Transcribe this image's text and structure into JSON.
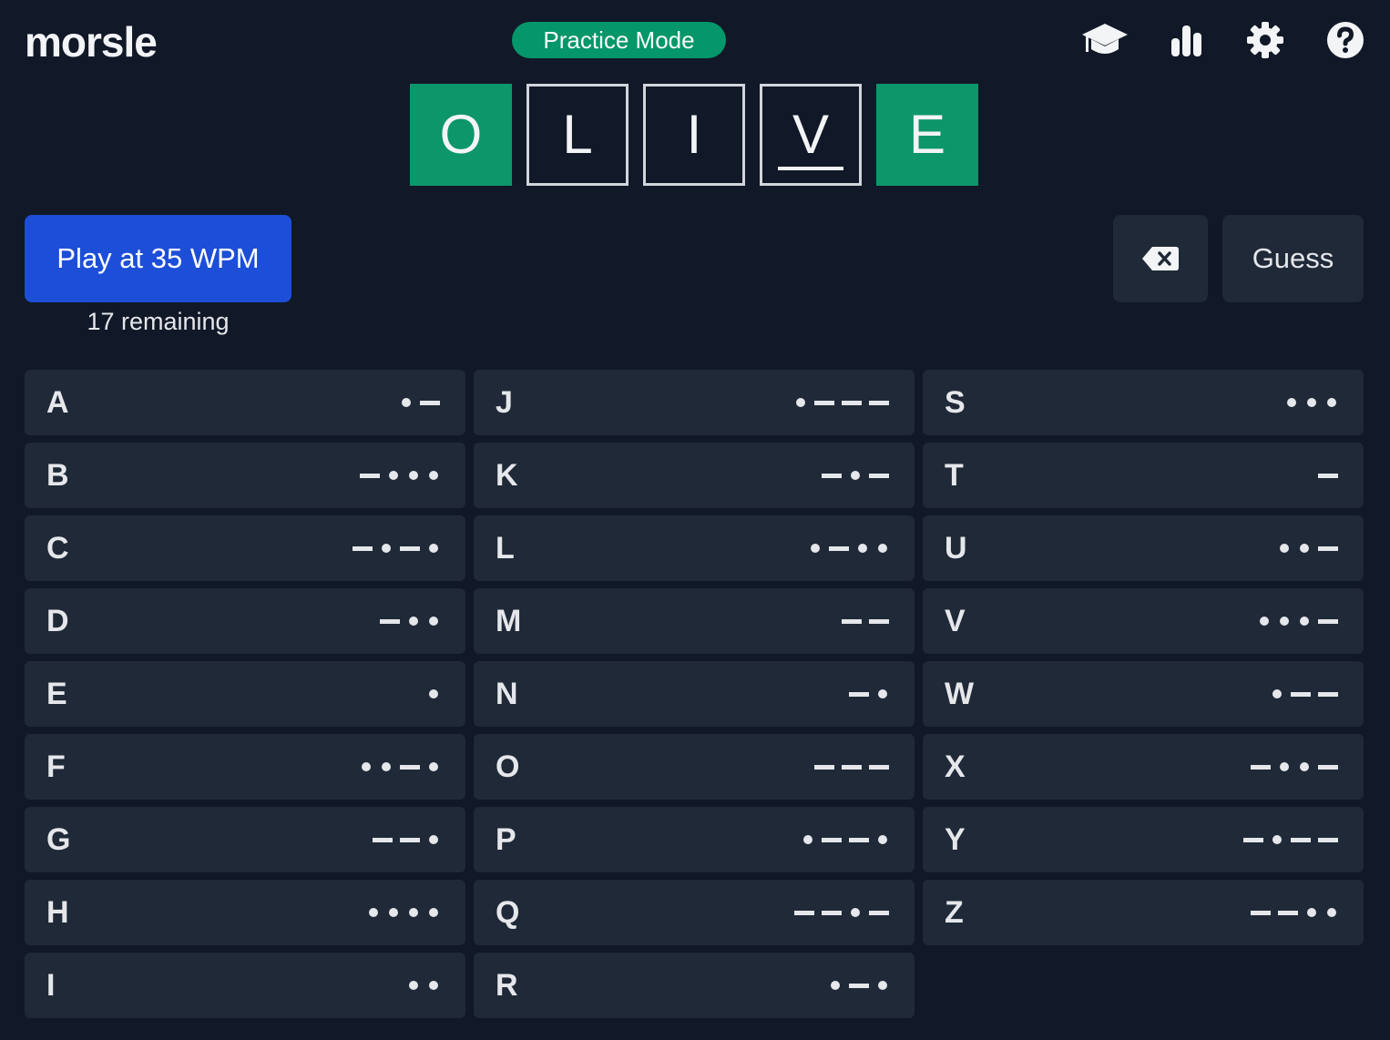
{
  "header": {
    "logo": "morsle",
    "mode": "Practice Mode",
    "icons": [
      "graduation-cap-icon",
      "stats-bars-icon",
      "gear-icon",
      "help-icon"
    ]
  },
  "board": {
    "tiles": [
      {
        "letter": "O",
        "state": "correct"
      },
      {
        "letter": "L",
        "state": "entered"
      },
      {
        "letter": "I",
        "state": "entered"
      },
      {
        "letter": "V",
        "state": "entered-active"
      },
      {
        "letter": "E",
        "state": "correct"
      }
    ]
  },
  "controls": {
    "play_label": "Play at 35 WPM",
    "remaining": "17 remaining",
    "guess_label": "Guess",
    "backspace_icon": "backspace-icon"
  },
  "colors": {
    "background": "#111827",
    "correct": "#0c966a",
    "primary": "#1d4ed8",
    "key": "#1f2937"
  },
  "keyboard": {
    "columns": [
      [
        {
          "letter": "A",
          "code": ".-"
        },
        {
          "letter": "B",
          "code": "-..."
        },
        {
          "letter": "C",
          "code": "-.-."
        },
        {
          "letter": "D",
          "code": "-.."
        },
        {
          "letter": "E",
          "code": "."
        },
        {
          "letter": "F",
          "code": "..-."
        },
        {
          "letter": "G",
          "code": "--."
        },
        {
          "letter": "H",
          "code": "...."
        },
        {
          "letter": "I",
          "code": ".."
        }
      ],
      [
        {
          "letter": "J",
          "code": ".---"
        },
        {
          "letter": "K",
          "code": "-.-"
        },
        {
          "letter": "L",
          "code": ".-.."
        },
        {
          "letter": "M",
          "code": "--"
        },
        {
          "letter": "N",
          "code": "-."
        },
        {
          "letter": "O",
          "code": "---"
        },
        {
          "letter": "P",
          "code": ".--."
        },
        {
          "letter": "Q",
          "code": "--.-"
        },
        {
          "letter": "R",
          "code": ".-."
        }
      ],
      [
        {
          "letter": "S",
          "code": "..."
        },
        {
          "letter": "T",
          "code": "-"
        },
        {
          "letter": "U",
          "code": "..-"
        },
        {
          "letter": "V",
          "code": "...-"
        },
        {
          "letter": "W",
          "code": ".--"
        },
        {
          "letter": "X",
          "code": "-..-"
        },
        {
          "letter": "Y",
          "code": "-.--"
        },
        {
          "letter": "Z",
          "code": "--.."
        }
      ]
    ]
  }
}
